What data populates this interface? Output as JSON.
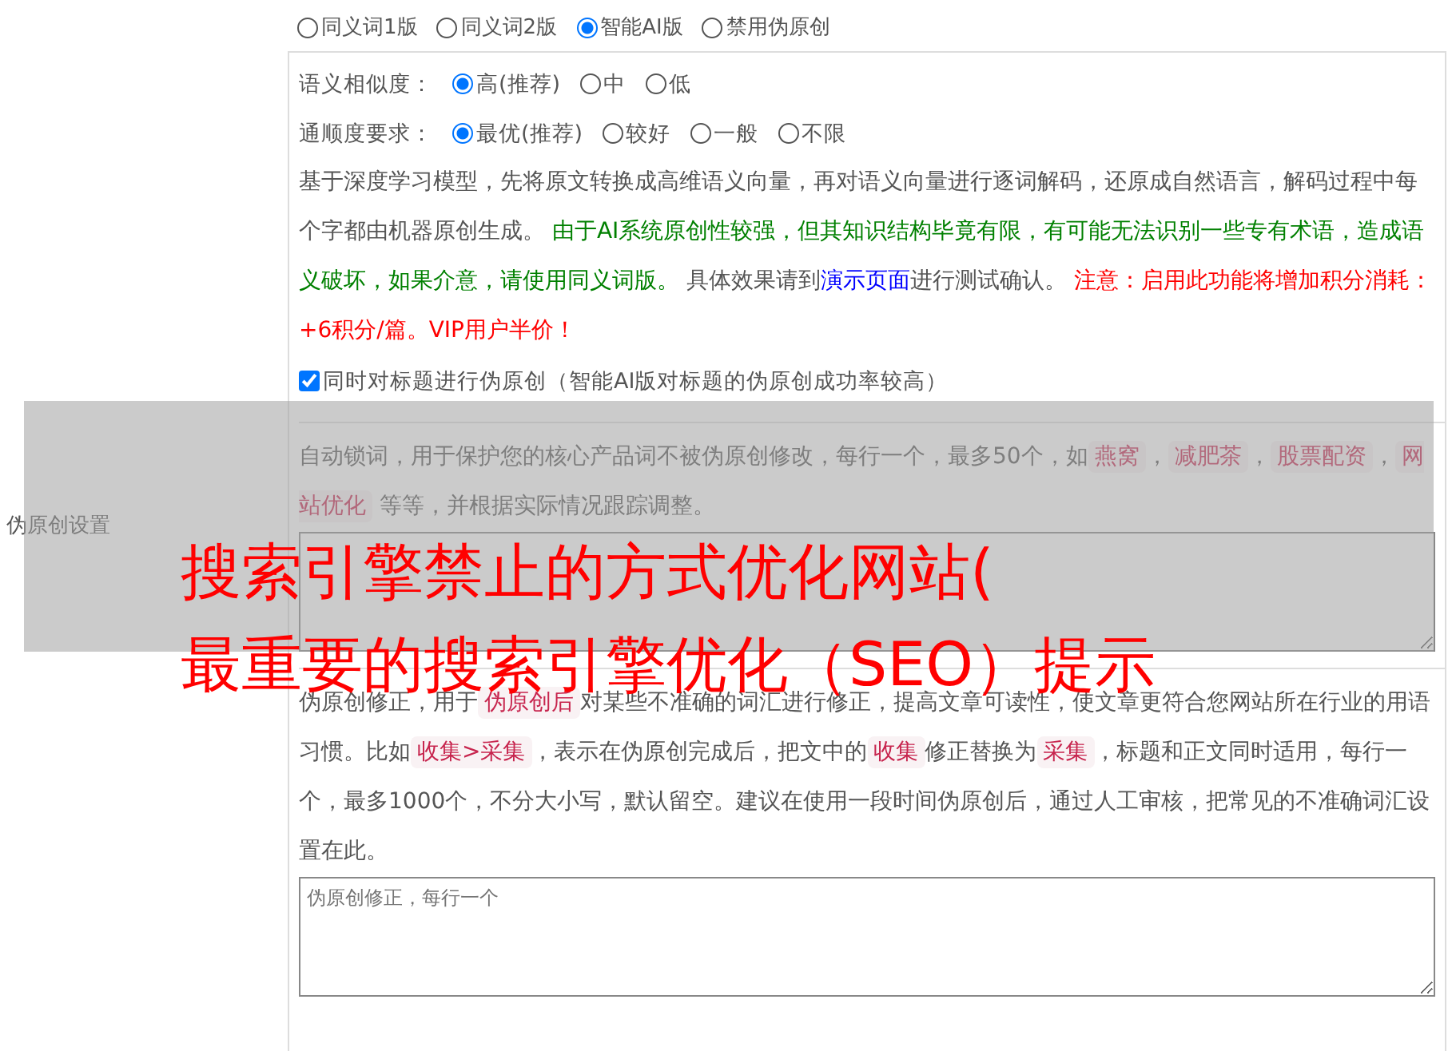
{
  "side_label": "伪原创设置",
  "modes": [
    {
      "label": "同义词1版",
      "selected": false
    },
    {
      "label": "同义词2版",
      "selected": false
    },
    {
      "label": "智能AI版",
      "selected": true
    },
    {
      "label": "禁用伪原创",
      "selected": false
    }
  ],
  "ai_settings": {
    "similarity": {
      "label": "语义相似度：",
      "options": [
        {
          "label": "高(推荐)",
          "selected": true
        },
        {
          "label": "中",
          "selected": false
        },
        {
          "label": "低",
          "selected": false
        }
      ]
    },
    "fluency": {
      "label": "通顺度要求：",
      "options": [
        {
          "label": "最优(推荐)",
          "selected": true
        },
        {
          "label": "较好",
          "selected": false
        },
        {
          "label": "一般",
          "selected": false
        },
        {
          "label": "不限",
          "selected": false
        }
      ]
    },
    "description": [
      {
        "kind": "plain",
        "text": "基于深度学习模型，先将原文转换成高维语义向量，再对语义向量进行逐词解码，还原成自然语言，解码过程中每个字都由机器原创生成。 "
      },
      {
        "kind": "green",
        "text": "由于AI系统原创性较强，但其知识结构毕竟有限，有可能无法识别一些专有术语，造成语义破坏，如果介意，请使用同义词版。"
      },
      {
        "kind": "plain",
        "text": " 具体效果请到"
      },
      {
        "kind": "link",
        "text": "演示页面"
      },
      {
        "kind": "plain",
        "text": "进行测试确认。 "
      },
      {
        "kind": "red",
        "text": "注意：启用此功能将增加积分消耗：+6积分/篇。VIP用户半价！"
      }
    ],
    "title_option": {
      "label": "同时对标题进行伪原创（智能AI版对标题的伪原创成功率较高）",
      "checked": true
    }
  },
  "lock_words": {
    "description": [
      {
        "kind": "plain",
        "text": "自动锁词，用于保护您的核心产品词不被伪原创修改，每行一个，最多50个，如"
      },
      {
        "kind": "tag",
        "text": "燕窝"
      },
      {
        "kind": "plain",
        "text": "，"
      },
      {
        "kind": "tag",
        "text": "减肥茶"
      },
      {
        "kind": "plain",
        "text": "，"
      },
      {
        "kind": "tag",
        "text": "股票配资"
      },
      {
        "kind": "plain",
        "text": "，"
      },
      {
        "kind": "tag",
        "text": "网站优化"
      },
      {
        "kind": "plain",
        "text": " 等等，并根据实际情况跟踪调整。"
      }
    ]
  },
  "correction": {
    "description": [
      {
        "kind": "plain",
        "text": "伪原创修正，用于"
      },
      {
        "kind": "tag",
        "text": "伪原创后"
      },
      {
        "kind": "plain",
        "text": "对某些不准确的词汇进行修正，提高文章可读性，使文章更符合您网站所在行业的用语习惯。比如"
      },
      {
        "kind": "tag",
        "text": "收集>采集"
      },
      {
        "kind": "plain",
        "text": "，表示在伪原创完成后，把文中的"
      },
      {
        "kind": "tag",
        "text": "收集"
      },
      {
        "kind": "plain",
        "text": "修正替换为"
      },
      {
        "kind": "tag",
        "text": "采集"
      },
      {
        "kind": "plain",
        "text": "，标题和正文同时适用，每行一个，最多1000个，不分大小写，默认留空。建议在使用一段时间伪原创后，通过人工审核，把常见的不准确词汇设置在此。"
      }
    ],
    "placeholder": "伪原创修正，每行一个"
  },
  "overlay": {
    "lines": [
      "搜索引擎禁止的方式优化网站(",
      "最重要的搜索引擎优化（SEO）提示"
    ]
  }
}
